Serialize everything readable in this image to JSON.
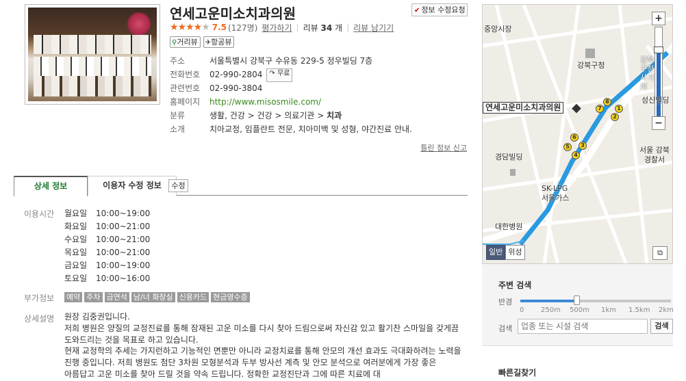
{
  "place": {
    "name": "연세고운미소치과의원",
    "edit_request": "정보 수정요청",
    "rating": {
      "stars_filled": 4,
      "stars_total": 5,
      "score": "7.5",
      "count": "(127명)",
      "rate_link": "평가하기"
    },
    "review": {
      "label": "리뷰",
      "count": "34",
      "unit": "개",
      "write_link": "리뷰 남기기"
    },
    "view_buttons": [
      {
        "label": "거리뷰",
        "icon": "streetview-icon"
      },
      {
        "label": "항공뷰",
        "icon": "airview-icon"
      }
    ],
    "info": {
      "address": {
        "key": "주소",
        "value": "서울특별시 강북구 수유동 229-5 정우빌딩 7층"
      },
      "phone": {
        "key": "전화번호",
        "value": "02-990-2804",
        "free_label": "무료"
      },
      "related": {
        "key": "관련번호",
        "value": "02-990-3804"
      },
      "homepage": {
        "key": "홈페이지",
        "value": "http://www.misosmile.com/"
      },
      "category": {
        "key": "분류",
        "path": "생활, 건강 > 건강 > 의료기관 > ",
        "leaf": "치과"
      },
      "intro": {
        "key": "소개",
        "value": "치아교정, 임플란트 전문, 치아미백 및 성형, 야간진료 안내."
      }
    },
    "report_link": "틀린 정보 신고"
  },
  "tabs": {
    "detail": "상세 정보",
    "user_edit": "이용자 수정 정보",
    "edit_button": "수정"
  },
  "detail": {
    "hours_label": "이용시간",
    "hours": [
      {
        "day": "월요일",
        "time": "10:00~19:00"
      },
      {
        "day": "화요일",
        "time": "10:00~21:00"
      },
      {
        "day": "수요일",
        "time": "10:00~21:00"
      },
      {
        "day": "목요일",
        "time": "10:00~21:00"
      },
      {
        "day": "금요일",
        "time": "10:00~19:00"
      },
      {
        "day": "토요일",
        "time": "10:00~16:00"
      }
    ],
    "extra_label": "부가정보",
    "tags": [
      "예약",
      "주차",
      "금연석",
      "남/녀 화장실",
      "신용카드",
      "현금영수증"
    ],
    "desc_label": "상세설명",
    "desc_lines": [
      "원장 김중권입니다.",
      "저희 병원은 양질의 교정진료를 통해 잠재된 고운 미소를 다시 찾아 드림으로써 자신감 있고 활기찬 스마일을 갖게끔 도와드리는 것을 목표로 하고 있습니다.",
      "현재 교정학의 추세는 가지런하고 기능적인 면뿐만 아니라 교정치료를 통해 안모의 개선 효과도 극대화하려는 노력을 진행 중입니다. 저희 병원도 첨단 3차원 모형분석과 두부 방사선 계측 및 안모 분석으로 여러분에게 가장 좋은 아름답고 고운 미소를 찾아 드릴 것을 약속 드립니다. 정확한 교정진단과 그에 따른 치료에 대"
    ]
  },
  "map": {
    "labels": [
      "중앙시장",
      "강북구청",
      "강북구청 사거리",
      "성신빌딩",
      "경담빌딩",
      "서울 강북경찰서",
      "SK-LPG 서울가스",
      "대한병원"
    ],
    "marker_label": "연세고운미소치과의원",
    "route_numbers": [
      "8",
      "7",
      "2",
      "1",
      "6",
      "5",
      "3",
      "4"
    ],
    "zoom_in": "+",
    "zoom_out": "−",
    "side_zoom_out": "−",
    "mode_buttons": [
      "일반",
      "위성"
    ],
    "route_color": "#2a9ae0",
    "pin_color": "#333333"
  },
  "nearby": {
    "title": "주변 검색",
    "radius_label": "반경",
    "radius_ticks": [
      "0",
      "250m",
      "500m",
      "1km",
      "1.5km",
      "2km"
    ],
    "radius_value_m": 500,
    "search_label": "검색",
    "search_placeholder": "업종 또는 시설 검색",
    "search_button": "검색"
  },
  "quick_route": "빠른길찾기"
}
